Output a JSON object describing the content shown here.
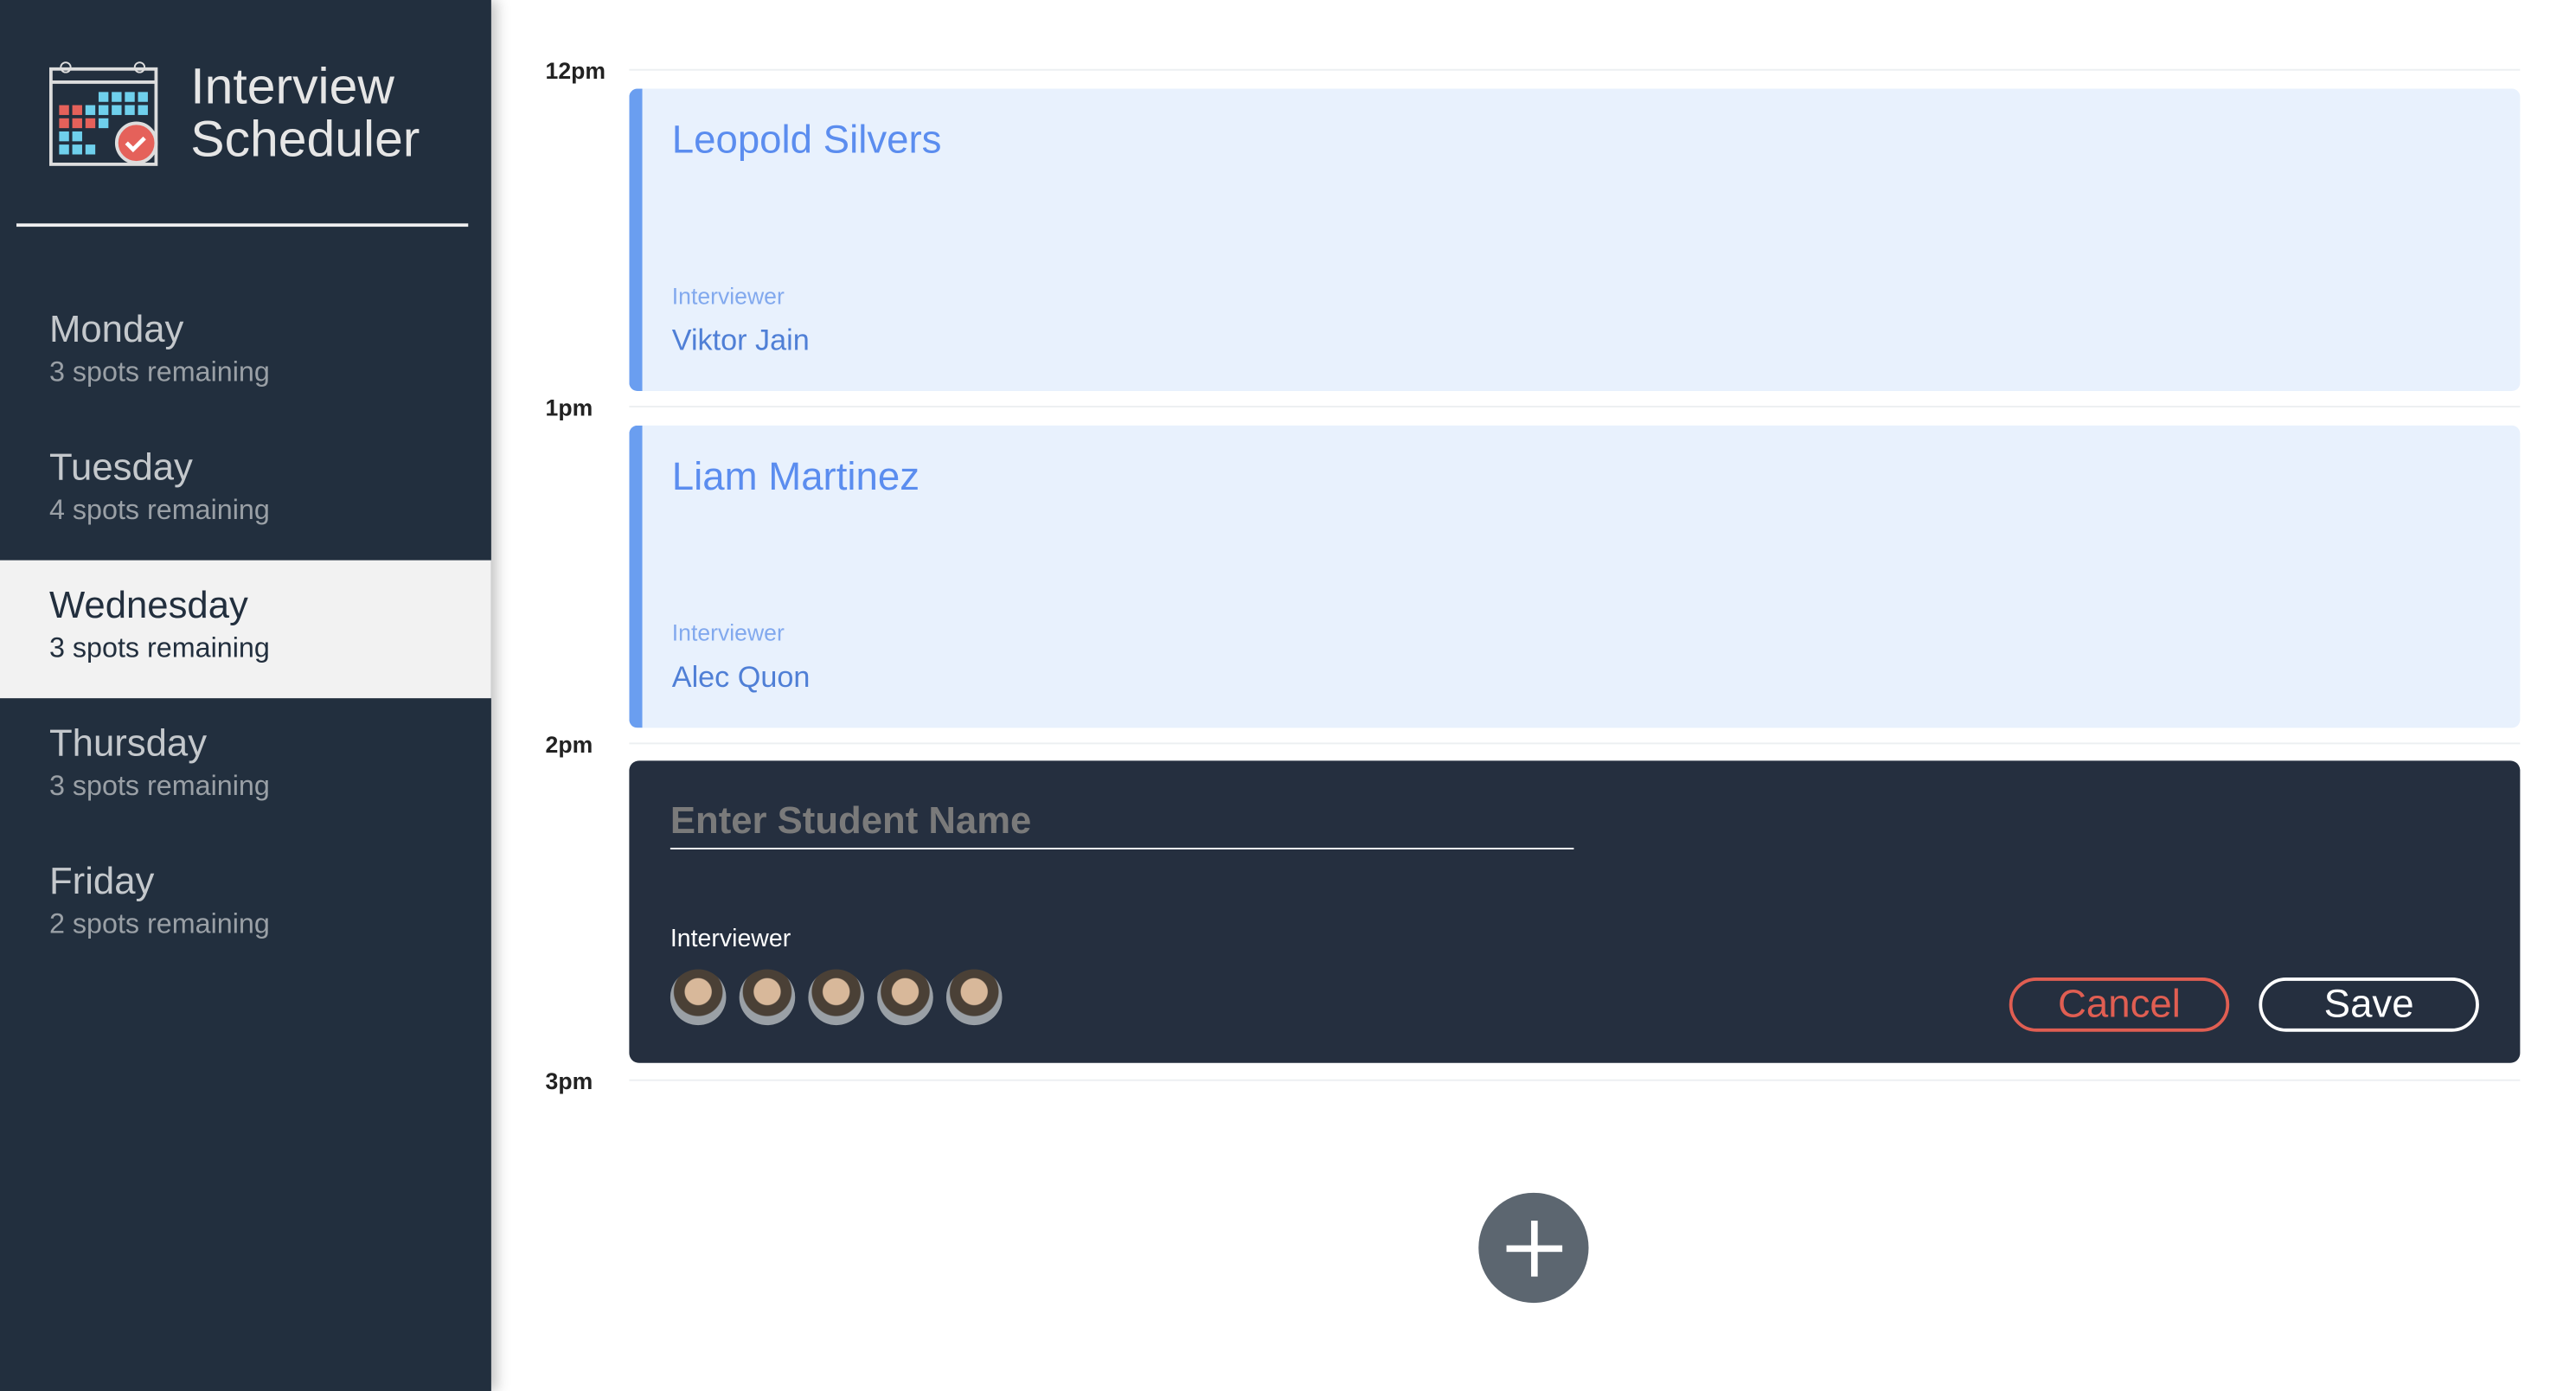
{
  "app": {
    "title_line1": "Interview",
    "title_line2": "Scheduler"
  },
  "days": [
    {
      "name": "Monday",
      "spots": "3 spots remaining"
    },
    {
      "name": "Tuesday",
      "spots": "4 spots remaining"
    },
    {
      "name": "Wednesday",
      "spots": "3 spots remaining",
      "selected": true
    },
    {
      "name": "Thursday",
      "spots": "3 spots remaining"
    },
    {
      "name": "Friday",
      "spots": "2 spots remaining"
    }
  ],
  "times": [
    "12pm",
    "1pm",
    "2pm",
    "3pm"
  ],
  "appointments": [
    {
      "student": "Leopold Silvers",
      "interviewer_label": "Interviewer",
      "interviewer": "Viktor Jain"
    },
    {
      "student": "Liam Martinez",
      "interviewer_label": "Interviewer",
      "interviewer": "Alec Quon"
    }
  ],
  "form": {
    "placeholder": "Enter Student Name",
    "value": "",
    "interviewer_label": "Interviewer",
    "interviewer_count": 5,
    "cancel": "Cancel",
    "save": "Save"
  },
  "colors": {
    "sidebar": "#222f3e",
    "accent": "#6a9ef0",
    "danger": "#e05e52"
  }
}
